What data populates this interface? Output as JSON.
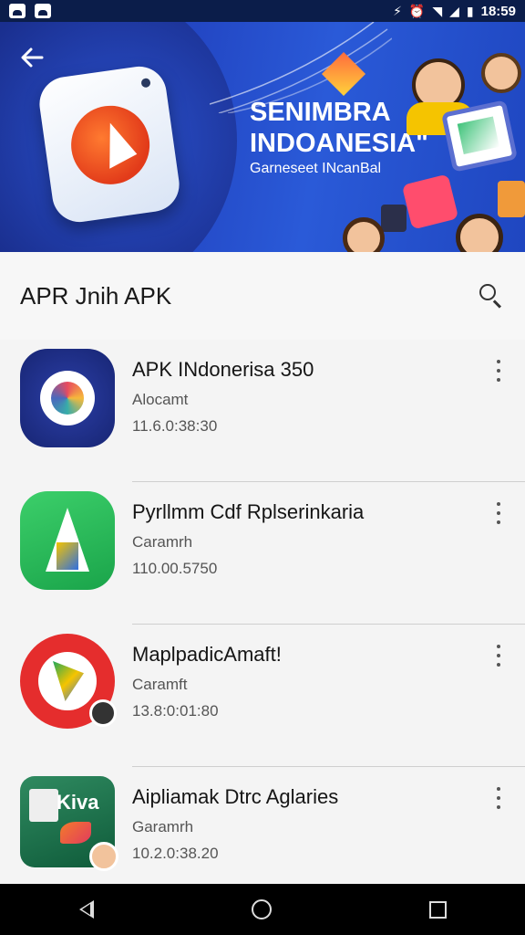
{
  "status_bar": {
    "time": "18:59"
  },
  "banner": {
    "title_line1": "SENIMBRA",
    "title_line2": "INDOANESIA\"",
    "subtitle": "Garneseet INcanBal"
  },
  "app_bar": {
    "title": "APR Jnih APK"
  },
  "apps": [
    {
      "name": "APK INdonerisa 350",
      "developer": "Alocamt",
      "version": "11.6.0:38:30"
    },
    {
      "name": "Pyrllmm Cdf Rplserinkaria",
      "developer": "Caramrh",
      "version": "110.00.5750"
    },
    {
      "name": "MaplpadicAmaft!",
      "developer": "Caramft",
      "version": "13.8:0:01:80"
    },
    {
      "name": "Aipliamak Dtrc Aglaries",
      "developer": "Garamrh",
      "version": "10.2.0:38.20"
    }
  ],
  "icons": {
    "back": "arrow-left-icon",
    "search": "search-icon",
    "more": "more-vert-icon"
  }
}
